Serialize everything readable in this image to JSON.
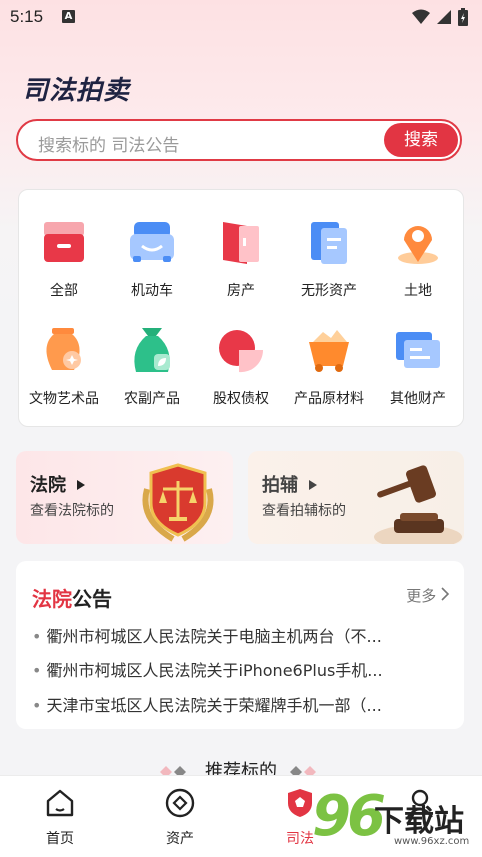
{
  "status_bar": {
    "time": "5:15",
    "notification_icon": "A"
  },
  "header": {
    "title": "司法拍卖"
  },
  "search": {
    "placeholder": "搜索标的 司法公告",
    "button_label": "搜索"
  },
  "categories": [
    {
      "label": "全部",
      "icon": "box-icon"
    },
    {
      "label": "机动车",
      "icon": "car-icon"
    },
    {
      "label": "房产",
      "icon": "door-icon"
    },
    {
      "label": "无形资产",
      "icon": "document-icon"
    },
    {
      "label": "土地",
      "icon": "location-pin-icon"
    },
    {
      "label": "文物艺术品",
      "icon": "vase-icon"
    },
    {
      "label": "农副产品",
      "icon": "sack-icon"
    },
    {
      "label": "股权债权",
      "icon": "pie-chart-icon"
    },
    {
      "label": "产品原材料",
      "icon": "mine-cart-icon"
    },
    {
      "label": "其他财产",
      "icon": "card-icon"
    }
  ],
  "promo": {
    "court": {
      "title": "法院",
      "subtitle": "查看法院标的"
    },
    "assist": {
      "title": "拍辅",
      "subtitle": "查看拍辅标的"
    }
  },
  "notices": {
    "title_red": "法院",
    "title_dark": "公告",
    "more": "更多",
    "items": [
      "衢州市柯城区人民法院关于电脑主机两台（不...",
      "衢州市柯城区人民法院关于iPhone6Plus手机...",
      "天津市宝坻区人民法院关于荣耀牌手机一部（..."
    ]
  },
  "recommend": {
    "title": "推荐标的"
  },
  "tabs": [
    {
      "label": "首页",
      "icon": "home-icon"
    },
    {
      "label": "资产",
      "icon": "diamond-circle-icon"
    },
    {
      "label": "司法",
      "icon": "shield-icon"
    },
    {
      "label": "",
      "icon": "user-icon"
    }
  ],
  "watermark": {
    "number": "96",
    "text": "下载站",
    "url": "www.96xz.com"
  },
  "colors": {
    "brand_red": "#e23543",
    "title_navy": "#1f2342",
    "watermark_green": "#7cc243"
  }
}
